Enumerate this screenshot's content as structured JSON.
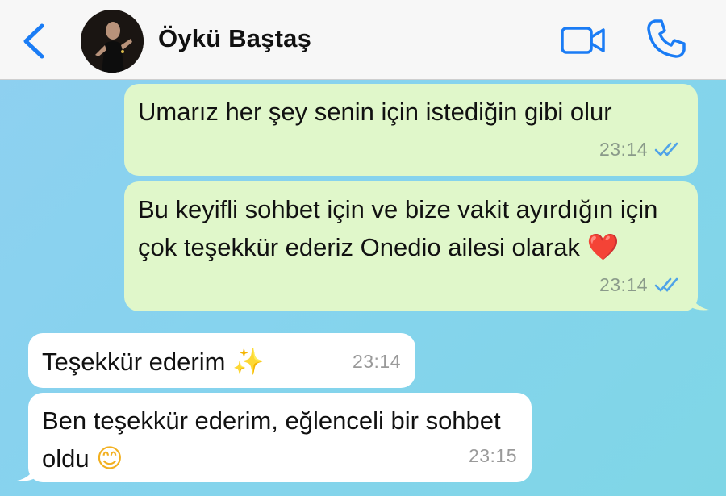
{
  "header": {
    "contact_name": "Öykü Baştaş",
    "back_icon": "chevron-left-icon",
    "video_icon": "video-camera-icon",
    "phone_icon": "phone-icon",
    "accent_color": "#1a7cf5"
  },
  "messages": [
    {
      "direction": "outgoing",
      "text": "Umarız her şey senin için istediğin gibi olur",
      "time": "23:14",
      "status": "read"
    },
    {
      "direction": "outgoing",
      "text": "Bu keyifli sohbet için ve bize vakit ayırdığın için çok teşekkür ederiz Onedio ailesi olarak",
      "emoji": "❤️",
      "time": "23:14",
      "status": "read"
    },
    {
      "direction": "incoming",
      "text": "Teşekkür ederim",
      "emoji": "✨",
      "time": "23:14"
    },
    {
      "direction": "incoming",
      "text": "Ben teşekkür ederim, eğlenceli bir sohbet oldu",
      "emoji": "😊",
      "time": "23:15"
    }
  ],
  "colors": {
    "outgoing_bubble": "#e0f7ca",
    "incoming_bubble": "#ffffff",
    "read_ticks": "#4fa3e8"
  }
}
